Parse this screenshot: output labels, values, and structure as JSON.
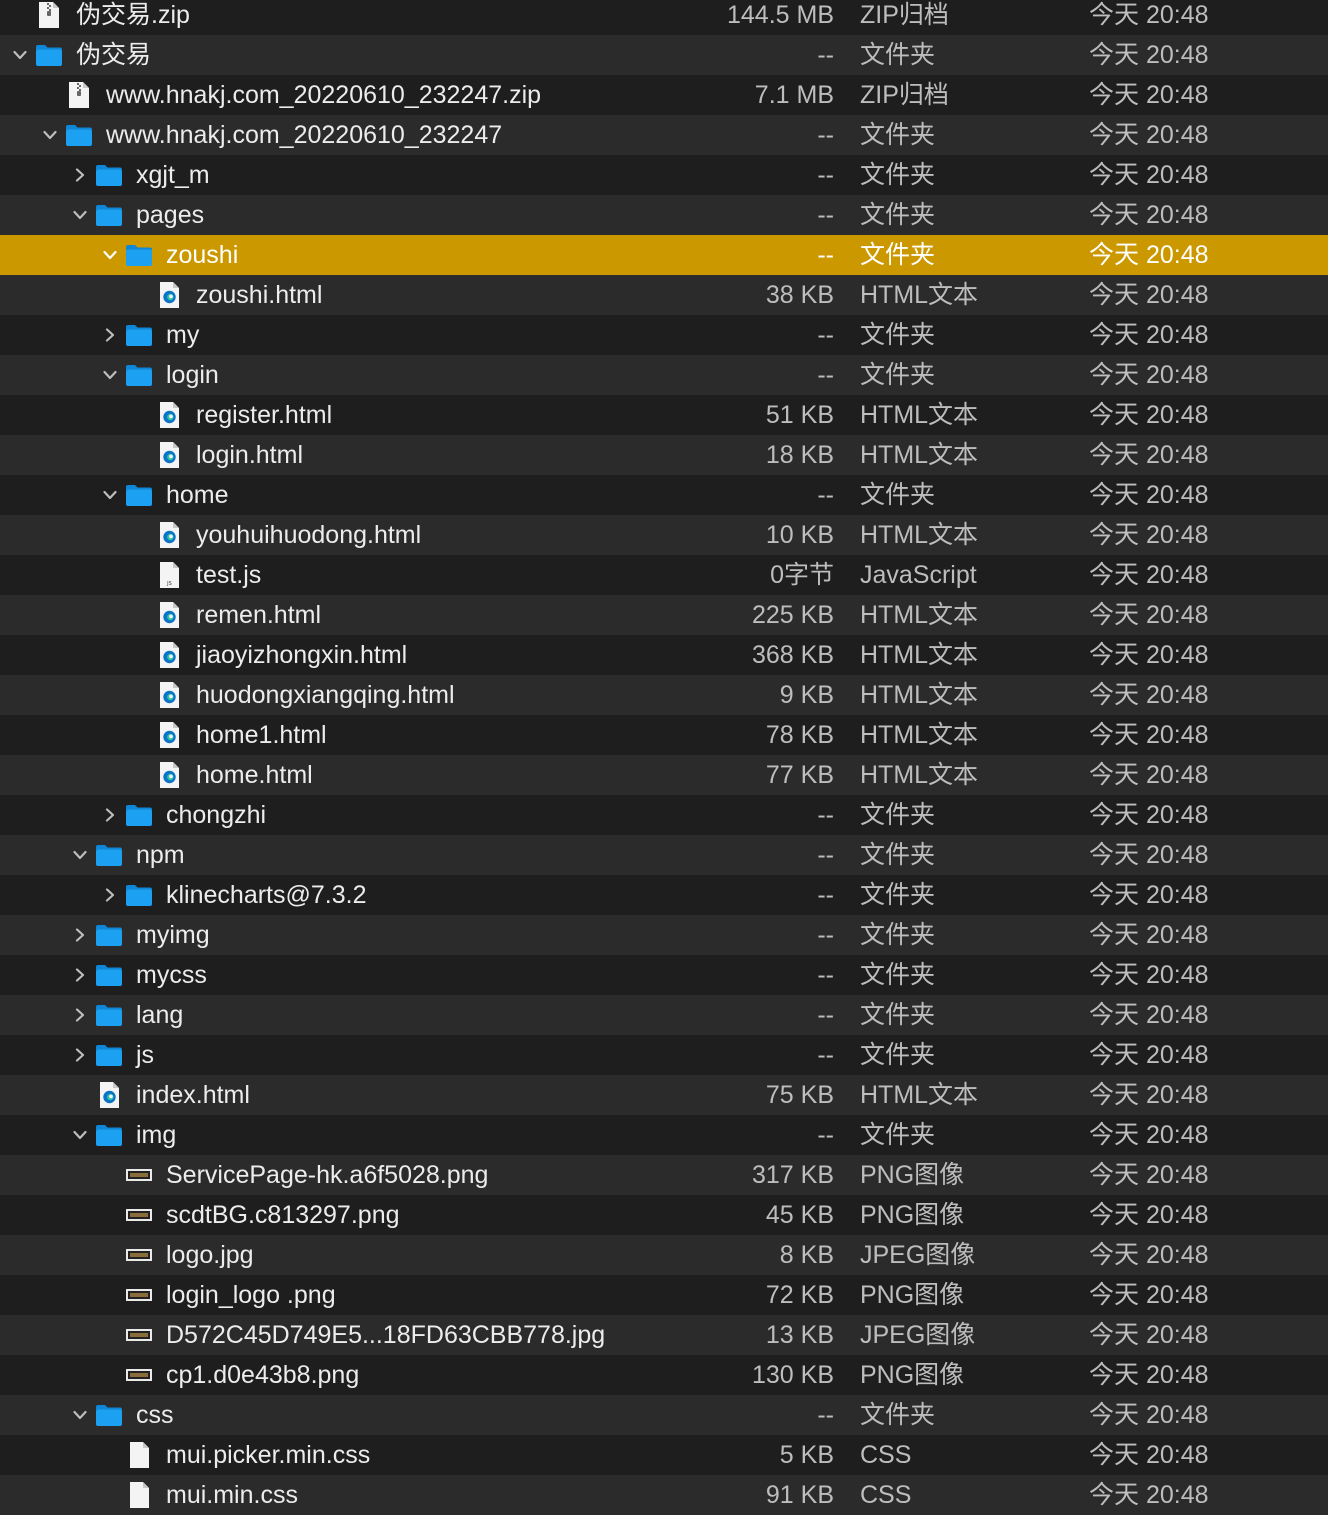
{
  "colors": {
    "background": "#1e1e1e",
    "row_alt": "#2b2b2b",
    "selection": "#cc9800",
    "folder_blue": "#1ca0f2"
  },
  "rows": [
    {
      "name": "伪交易.zip",
      "size": "144.5 MB",
      "kind": "ZIP归档",
      "date": "今天 20:48",
      "level": 0,
      "icon": "zip-icon",
      "disclosure": "none"
    },
    {
      "name": "伪交易",
      "size": "--",
      "kind": "文件夹",
      "date": "今天 20:48",
      "level": 0,
      "icon": "folder-icon",
      "disclosure": "expanded"
    },
    {
      "name": "www.hnakj.com_20220610_232247.zip",
      "size": "7.1 MB",
      "kind": "ZIP归档",
      "date": "今天 20:48",
      "level": 1,
      "icon": "zip-icon",
      "disclosure": "none"
    },
    {
      "name": "www.hnakj.com_20220610_232247",
      "size": "--",
      "kind": "文件夹",
      "date": "今天 20:48",
      "level": 1,
      "icon": "folder-icon",
      "disclosure": "expanded"
    },
    {
      "name": "xgjt_m",
      "size": "--",
      "kind": "文件夹",
      "date": "今天 20:48",
      "level": 2,
      "icon": "folder-icon",
      "disclosure": "collapsed"
    },
    {
      "name": "pages",
      "size": "--",
      "kind": "文件夹",
      "date": "今天 20:48",
      "level": 2,
      "icon": "folder-icon",
      "disclosure": "expanded"
    },
    {
      "name": "zoushi",
      "size": "--",
      "kind": "文件夹",
      "date": "今天 20:48",
      "level": 3,
      "icon": "folder-icon",
      "disclosure": "expanded",
      "selected": true
    },
    {
      "name": "zoushi.html",
      "size": "38 KB",
      "kind": "HTML文本",
      "date": "今天 20:48",
      "level": 4,
      "icon": "html-file-icon",
      "disclosure": "none"
    },
    {
      "name": "my",
      "size": "--",
      "kind": "文件夹",
      "date": "今天 20:48",
      "level": 3,
      "icon": "folder-icon",
      "disclosure": "collapsed"
    },
    {
      "name": "login",
      "size": "--",
      "kind": "文件夹",
      "date": "今天 20:48",
      "level": 3,
      "icon": "folder-icon",
      "disclosure": "expanded"
    },
    {
      "name": "register.html",
      "size": "51 KB",
      "kind": "HTML文本",
      "date": "今天 20:48",
      "level": 4,
      "icon": "html-file-icon",
      "disclosure": "none"
    },
    {
      "name": "login.html",
      "size": "18 KB",
      "kind": "HTML文本",
      "date": "今天 20:48",
      "level": 4,
      "icon": "html-file-icon",
      "disclosure": "none"
    },
    {
      "name": "home",
      "size": "--",
      "kind": "文件夹",
      "date": "今天 20:48",
      "level": 3,
      "icon": "folder-icon",
      "disclosure": "expanded"
    },
    {
      "name": "youhuihuodong.html",
      "size": "10 KB",
      "kind": "HTML文本",
      "date": "今天 20:48",
      "level": 4,
      "icon": "html-file-icon",
      "disclosure": "none"
    },
    {
      "name": "test.js",
      "size": "0字节",
      "kind": "JavaScript",
      "date": "今天 20:48",
      "level": 4,
      "icon": "js-file-icon",
      "disclosure": "none"
    },
    {
      "name": "remen.html",
      "size": "225 KB",
      "kind": "HTML文本",
      "date": "今天 20:48",
      "level": 4,
      "icon": "html-file-icon",
      "disclosure": "none"
    },
    {
      "name": "jiaoyizhongxin.html",
      "size": "368 KB",
      "kind": "HTML文本",
      "date": "今天 20:48",
      "level": 4,
      "icon": "html-file-icon",
      "disclosure": "none"
    },
    {
      "name": "huodongxiangqing.html",
      "size": "9 KB",
      "kind": "HTML文本",
      "date": "今天 20:48",
      "level": 4,
      "icon": "html-file-icon",
      "disclosure": "none"
    },
    {
      "name": "home1.html",
      "size": "78 KB",
      "kind": "HTML文本",
      "date": "今天 20:48",
      "level": 4,
      "icon": "html-file-icon",
      "disclosure": "none"
    },
    {
      "name": "home.html",
      "size": "77 KB",
      "kind": "HTML文本",
      "date": "今天 20:48",
      "level": 4,
      "icon": "html-file-icon",
      "disclosure": "none"
    },
    {
      "name": "chongzhi",
      "size": "--",
      "kind": "文件夹",
      "date": "今天 20:48",
      "level": 3,
      "icon": "folder-icon",
      "disclosure": "collapsed"
    },
    {
      "name": "npm",
      "size": "--",
      "kind": "文件夹",
      "date": "今天 20:48",
      "level": 2,
      "icon": "folder-icon",
      "disclosure": "expanded"
    },
    {
      "name": "klinecharts@7.3.2",
      "size": "--",
      "kind": "文件夹",
      "date": "今天 20:48",
      "level": 3,
      "icon": "folder-icon",
      "disclosure": "collapsed"
    },
    {
      "name": "myimg",
      "size": "--",
      "kind": "文件夹",
      "date": "今天 20:48",
      "level": 2,
      "icon": "folder-icon",
      "disclosure": "collapsed"
    },
    {
      "name": "mycss",
      "size": "--",
      "kind": "文件夹",
      "date": "今天 20:48",
      "level": 2,
      "icon": "folder-icon",
      "disclosure": "collapsed"
    },
    {
      "name": "lang",
      "size": "--",
      "kind": "文件夹",
      "date": "今天 20:48",
      "level": 2,
      "icon": "folder-icon",
      "disclosure": "collapsed"
    },
    {
      "name": "js",
      "size": "--",
      "kind": "文件夹",
      "date": "今天 20:48",
      "level": 2,
      "icon": "folder-icon",
      "disclosure": "collapsed"
    },
    {
      "name": "index.html",
      "size": "75 KB",
      "kind": "HTML文本",
      "date": "今天 20:48",
      "level": 2,
      "icon": "html-file-icon",
      "disclosure": "none"
    },
    {
      "name": "img",
      "size": "--",
      "kind": "文件夹",
      "date": "今天 20:48",
      "level": 2,
      "icon": "folder-icon",
      "disclosure": "expanded"
    },
    {
      "name": "ServicePage-hk.a6f5028.png",
      "size": "317 KB",
      "kind": "PNG图像",
      "date": "今天 20:48",
      "level": 3,
      "icon": "image-thumbnail-icon",
      "disclosure": "none"
    },
    {
      "name": "scdtBG.c813297.png",
      "size": "45 KB",
      "kind": "PNG图像",
      "date": "今天 20:48",
      "level": 3,
      "icon": "image-thumbnail-icon",
      "disclosure": "none"
    },
    {
      "name": "logo.jpg",
      "size": "8 KB",
      "kind": "JPEG图像",
      "date": "今天 20:48",
      "level": 3,
      "icon": "image-thumbnail-icon",
      "disclosure": "none"
    },
    {
      "name": "login_logo .png",
      "size": "72 KB",
      "kind": "PNG图像",
      "date": "今天 20:48",
      "level": 3,
      "icon": "image-thumbnail-icon",
      "disclosure": "none"
    },
    {
      "name": "D572C45D749E5...18FD63CBB778.jpg",
      "size": "13 KB",
      "kind": "JPEG图像",
      "date": "今天 20:48",
      "level": 3,
      "icon": "image-thumbnail-icon",
      "disclosure": "none"
    },
    {
      "name": "cp1.d0e43b8.png",
      "size": "130 KB",
      "kind": "PNG图像",
      "date": "今天 20:48",
      "level": 3,
      "icon": "image-thumbnail-icon",
      "disclosure": "none"
    },
    {
      "name": "css",
      "size": "--",
      "kind": "文件夹",
      "date": "今天 20:48",
      "level": 2,
      "icon": "folder-icon",
      "disclosure": "expanded"
    },
    {
      "name": "mui.picker.min.css",
      "size": "5 KB",
      "kind": "CSS",
      "date": "今天 20:48",
      "level": 3,
      "icon": "document-icon",
      "disclosure": "none"
    },
    {
      "name": "mui.min.css",
      "size": "91 KB",
      "kind": "CSS",
      "date": "今天 20:48",
      "level": 3,
      "icon": "document-icon",
      "disclosure": "none"
    }
  ]
}
